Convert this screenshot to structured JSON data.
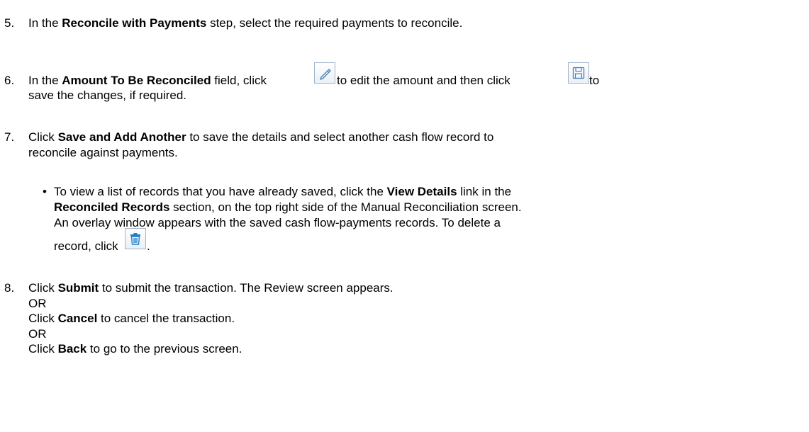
{
  "steps": {
    "s5": {
      "number": "5.",
      "pre": "In the ",
      "bold": "Reconcile with Payments",
      "post": " step, select the required payments to reconcile."
    },
    "s6": {
      "number": "6.",
      "pre": "In the ",
      "bold": "Amount To Be Reconciled",
      "mid1": " field, click ",
      "mid2": " to edit the amount and then click ",
      "end": "to",
      "line2": "save the changes, if required.",
      "edit_icon": "pencil-edit-icon",
      "save_icon": "floppy-save-icon"
    },
    "s7": {
      "number": "7.",
      "pre": "Click ",
      "bold": "Save and Add Another",
      "post": " to save the details and select another cash flow record to",
      "line2": "reconcile against payments.",
      "bullet": {
        "symbol": "•",
        "pre": "To view a list of records that you have already saved, click the ",
        "bold1": "View Details",
        "post1": " link in the",
        "bold2": "Reconciled Records",
        "post2": " section, on the top right side of the Manual Reconciliation screen.",
        "line3": "An overlay window appears with the saved cash flow-payments records. To delete a",
        "line4_pre": "record, click",
        "line4_post": ".",
        "delete_icon": "trash-delete-icon"
      }
    },
    "s8": {
      "number": "8.",
      "pre": "Click ",
      "bold1": "Submit",
      "post1": " to submit the transaction. The Review screen appears.",
      "or1": "OR",
      "pre2": "Click ",
      "bold2": "Cancel",
      "post2": " to cancel the transaction.",
      "or2": "OR",
      "pre3": "Click ",
      "bold3": "Back",
      "post3": " to go to the previous screen."
    }
  }
}
